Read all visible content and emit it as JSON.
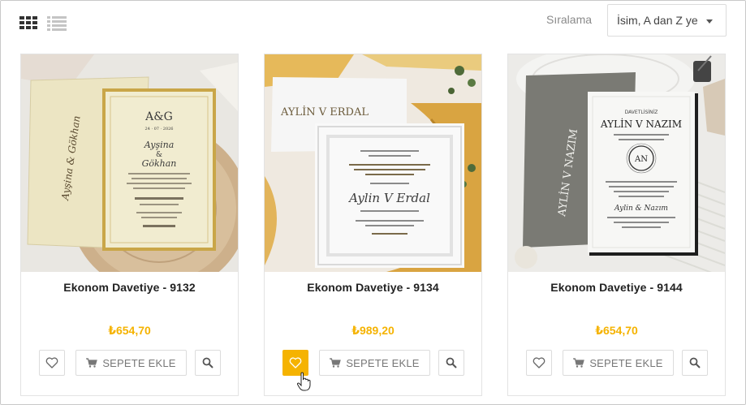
{
  "toolbar": {
    "grid_view_icon": "grid-icon",
    "list_view_icon": "list-icon",
    "sort_label": "Sıralama",
    "sort_value": "İsim, A dan Z ye"
  },
  "products": [
    {
      "title": "Ekonom Davetiye - 9132",
      "price": "₺654,70",
      "cart_label": "SEPETE EKLE",
      "wishlist_active": false,
      "image": {
        "monogram": "A&G",
        "date": "24.07.2026",
        "names_first": "Ayşina",
        "names_second": "Gökhan",
        "envelope_text": "Ayşina & Gökhan",
        "palette": "cream-gold"
      }
    },
    {
      "title": "Ekonom Davetiye - 9134",
      "price": "₺989,20",
      "cart_label": "SEPETE EKLE",
      "wishlist_active": true,
      "image": {
        "envelope_text": "AYLİN V ERDAL",
        "names": "Aylin V Erdal",
        "palette": "white-gold"
      }
    },
    {
      "title": "Ekonom Davetiye - 9144",
      "price": "₺654,70",
      "cart_label": "SEPETE EKLE",
      "wishlist_active": false,
      "image": {
        "header": "DAVETLİSİNİZ",
        "names": "AYLİN V NAZIM",
        "monogram": "AN",
        "envelope_text": "AYLİN V NAZIM",
        "palette": "grey-white"
      }
    }
  ],
  "colors": {
    "accent": "#f5b301",
    "border": "#dcdcdc",
    "text_muted": "#8a8a8a"
  }
}
